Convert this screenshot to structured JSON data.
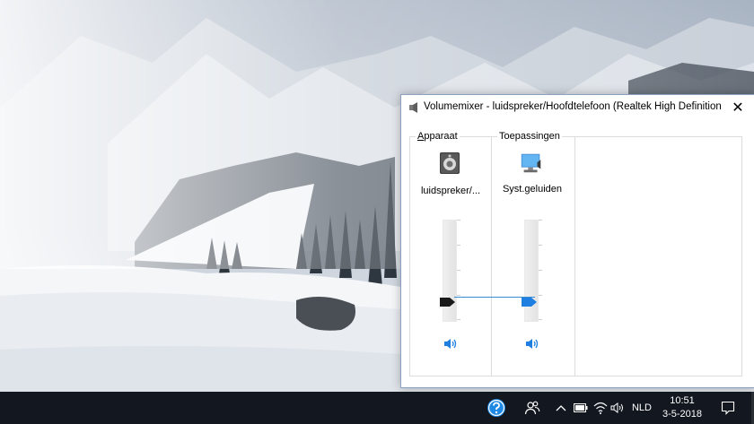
{
  "window": {
    "title": "Volumemixer - luidspreker/Hoofdtelefoon (Realtek High Definition ...",
    "title_icon": "speaker-icon",
    "close_icon": "close-icon",
    "close_glyph": "✕"
  },
  "groups": {
    "device_label_accel": "A",
    "device_label_rest": "pparaat",
    "apps_label": "Toepassingen"
  },
  "channels": [
    {
      "name": "luidspreker/...",
      "icon": "speaker-device-icon",
      "volume": 0.18,
      "mute_icon": "volume-icon"
    },
    {
      "name": "Syst.geluiden",
      "icon": "system-sounds-icon",
      "volume": 0.18,
      "mute_icon": "volume-icon"
    }
  ],
  "taskbar": {
    "help_icon": "help-icon",
    "people_icon": "people-icon",
    "chevron_icon": "chevron-up-icon",
    "battery_icon": "battery-icon",
    "wifi_icon": "wifi-icon",
    "volume_icon": "volume-icon",
    "language": "NLD",
    "time": "10:51",
    "date": "3-5-2018",
    "notification_icon": "notification-icon"
  },
  "colors": {
    "accent": "#1e7fe0",
    "device_thumb": "#1a1a1a",
    "taskbar": "#131820"
  }
}
